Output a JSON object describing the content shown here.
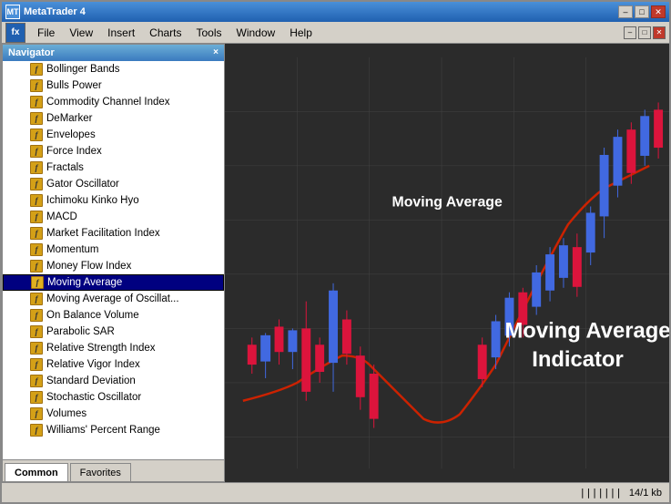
{
  "window": {
    "title": "MetaTrader 4",
    "icon": "MT"
  },
  "titlebar": {
    "minimize": "–",
    "maximize": "□",
    "close": "✕"
  },
  "menubar": {
    "logo": "fx",
    "items": [
      "File",
      "View",
      "Insert",
      "Charts",
      "Tools",
      "Window",
      "Help"
    ]
  },
  "navigator": {
    "title": "Navigator",
    "close_label": "×",
    "indicators": [
      "Bollinger Bands",
      "Bulls Power",
      "Commodity Channel Index",
      "DeMarker",
      "Envelopes",
      "Force Index",
      "Fractals",
      "Gator Oscillator",
      "Ichimoku Kinko Hyo",
      "MACD",
      "Market Facilitation Index",
      "Momentum",
      "Money Flow Index",
      "Moving Average",
      "Moving Average of Oscillat...",
      "On Balance Volume",
      "Parabolic SAR",
      "Relative Strength Index",
      "Relative Vigor Index",
      "Standard Deviation",
      "Stochastic Oscillator",
      "Volumes",
      "Williams' Percent Range"
    ],
    "selected_index": 13,
    "tabs": [
      "Common",
      "Favorites"
    ]
  },
  "chart": {
    "label1": "Moving Average",
    "label2": "Moving Average",
    "label3": "Indicator"
  },
  "statusbar": {
    "indicator": "|||||||",
    "size": "14/1 kb"
  }
}
